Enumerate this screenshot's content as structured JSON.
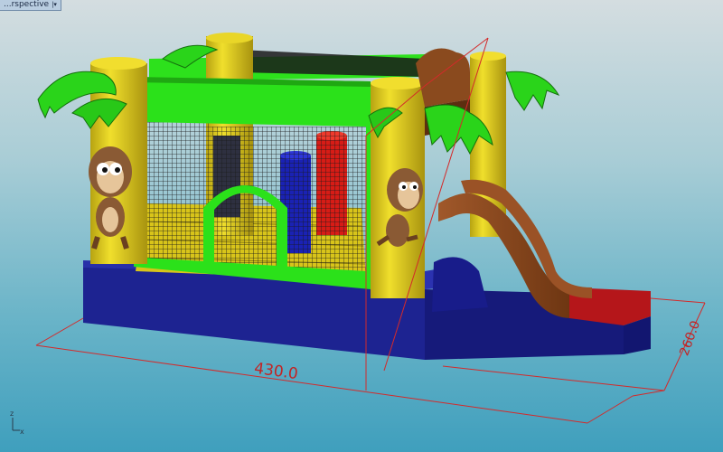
{
  "viewport": {
    "name": "Perspective",
    "label_visible": "...rspective"
  },
  "dimensions": {
    "length": "430.0",
    "width": "260.0"
  },
  "axis_gizmo": {
    "x_label": "x",
    "z_label": "z"
  },
  "colors": {
    "dimension": "#d42a2a",
    "base": "#1c1f9a",
    "wall": "#2ddf1a",
    "column": "#e8d21e",
    "slide": "#8a4a1e",
    "landing": "#b51818"
  }
}
